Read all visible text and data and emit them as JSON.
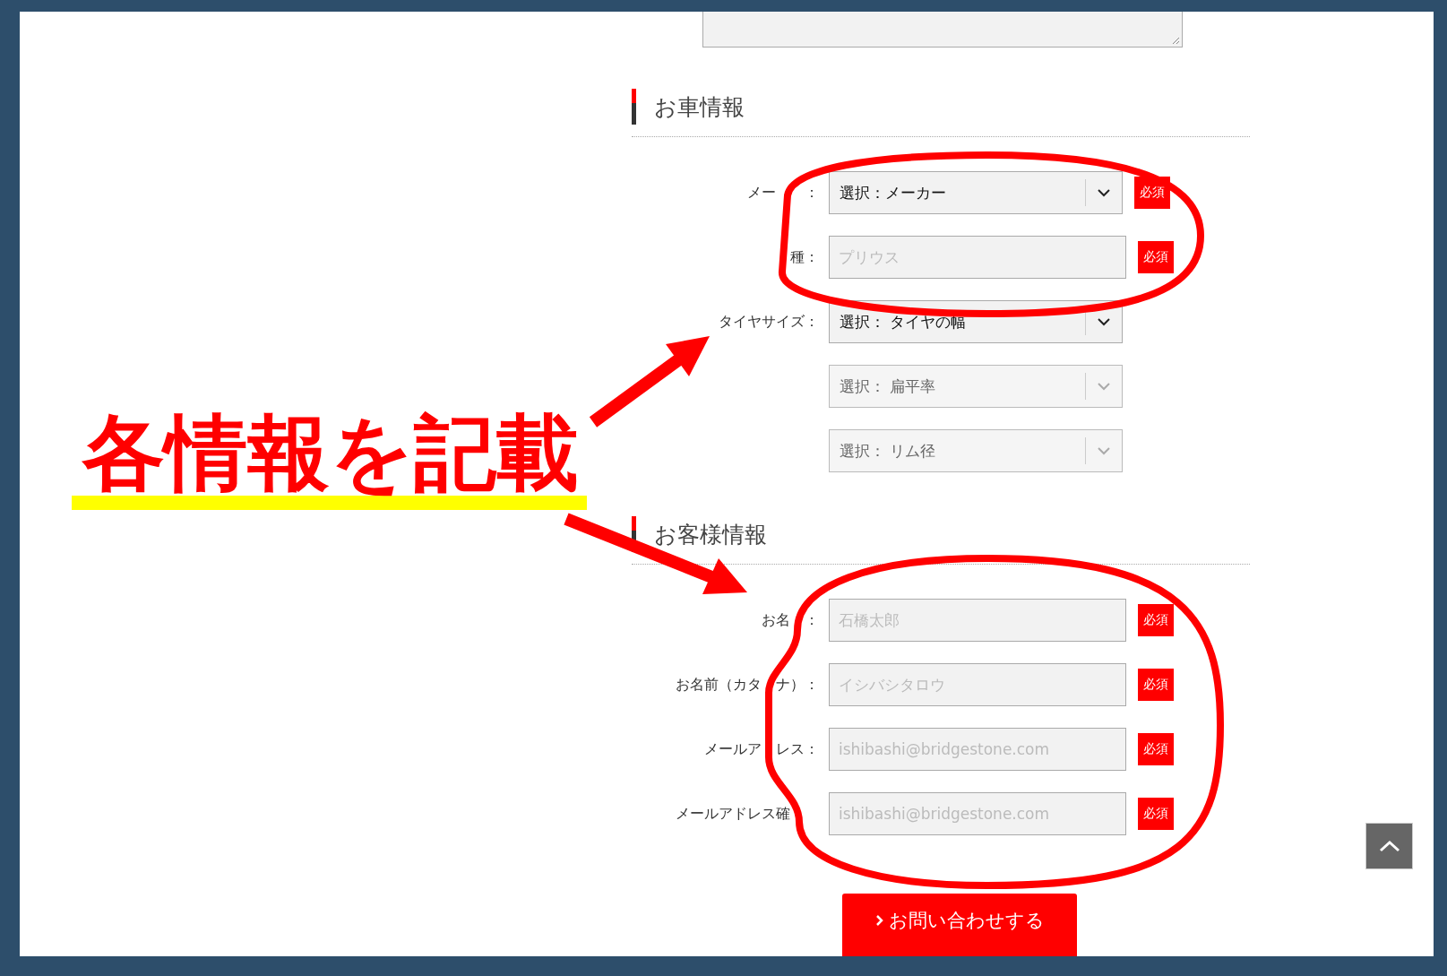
{
  "comment_box": {
    "resizable": true
  },
  "sections": [
    {
      "title": "お車情報",
      "fields": [
        {
          "label": "メー　　：",
          "kind": "select",
          "value": "選択：メーカー",
          "disabled": false,
          "badge": "必須"
        },
        {
          "label": "種：",
          "kind": "text",
          "placeholder": "プリウス",
          "badge": "必須"
        },
        {
          "label": "タイヤサイズ：",
          "kind": "select",
          "value": "選択： タイヤの幅",
          "disabled": false
        },
        {
          "kind": "select",
          "value": "選択： 扁平率",
          "disabled": true
        },
        {
          "kind": "select",
          "value": "選択： リム径",
          "disabled": true
        }
      ]
    },
    {
      "title": "お客様情報",
      "fields": [
        {
          "label": "お名　：",
          "kind": "text",
          "placeholder": "石橋太郎",
          "badge": "必須"
        },
        {
          "label": "お名前（カタ　ナ）：",
          "kind": "text",
          "placeholder": "イシバシタロウ",
          "badge": "必須"
        },
        {
          "label": "メールア　レス：",
          "kind": "text",
          "placeholder": "ishibashi@bridgestone.com",
          "badge": "必須"
        },
        {
          "label": "メールアドレス確　　",
          "kind": "text",
          "placeholder": "ishibashi@bridgestone.com",
          "badge": "必須"
        }
      ]
    }
  ],
  "submit": {
    "label": "お問い合わせする"
  },
  "annotation": {
    "caption": "各情報を記載"
  }
}
